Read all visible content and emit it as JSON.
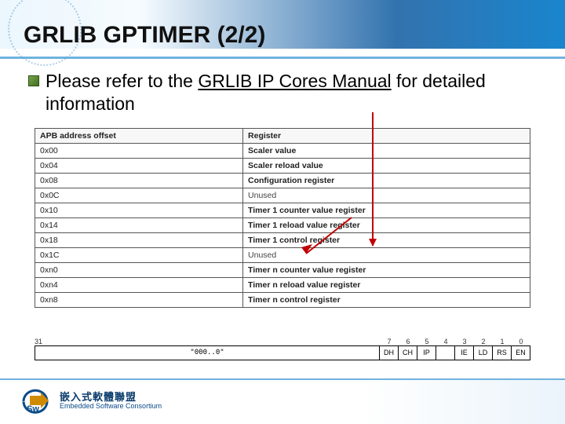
{
  "title": "GRLIB GPTIMER (2/2)",
  "bullet": {
    "text_before": "Please refer to the ",
    "link": "GRLIB IP Cores Manual",
    "text_after": " for detailed information"
  },
  "table": {
    "headers": [
      "APB address offset",
      "Register"
    ],
    "rows": [
      {
        "offset": "0x00",
        "reg": "Scaler value",
        "bold": true
      },
      {
        "offset": "0x04",
        "reg": "Scaler reload value",
        "bold": true
      },
      {
        "offset": "0x08",
        "reg": "Configuration register",
        "bold": true
      },
      {
        "offset": "0x0C",
        "reg": "Unused",
        "bold": false
      },
      {
        "offset": "0x10",
        "reg": "Timer 1 counter value register",
        "bold": true
      },
      {
        "offset": "0x14",
        "reg": "Timer 1 reload value register",
        "bold": true
      },
      {
        "offset": "0x18",
        "reg": "Timer 1 control register",
        "bold": true
      },
      {
        "offset": "0x1C",
        "reg": "Unused",
        "bold": false
      },
      {
        "offset": "0xn0",
        "reg": "Timer n counter value register",
        "bold": true
      },
      {
        "offset": "0xn4",
        "reg": "Timer n reload value register",
        "bold": true
      },
      {
        "offset": "0xn8",
        "reg": "Timer n control register",
        "bold": true
      }
    ]
  },
  "bitfield": {
    "msb": "31",
    "pad_nums": [
      "7",
      "6",
      "5",
      "4",
      "3",
      "2",
      "1",
      "0"
    ],
    "wide_label": "\"000..0\"",
    "cells": [
      "DH",
      "CH",
      "IP",
      "",
      "IE",
      "LD",
      "RS",
      "EN"
    ]
  },
  "footer": {
    "zh": "嵌入式軟體聯盟",
    "en": "Embedded Software Consortium"
  }
}
